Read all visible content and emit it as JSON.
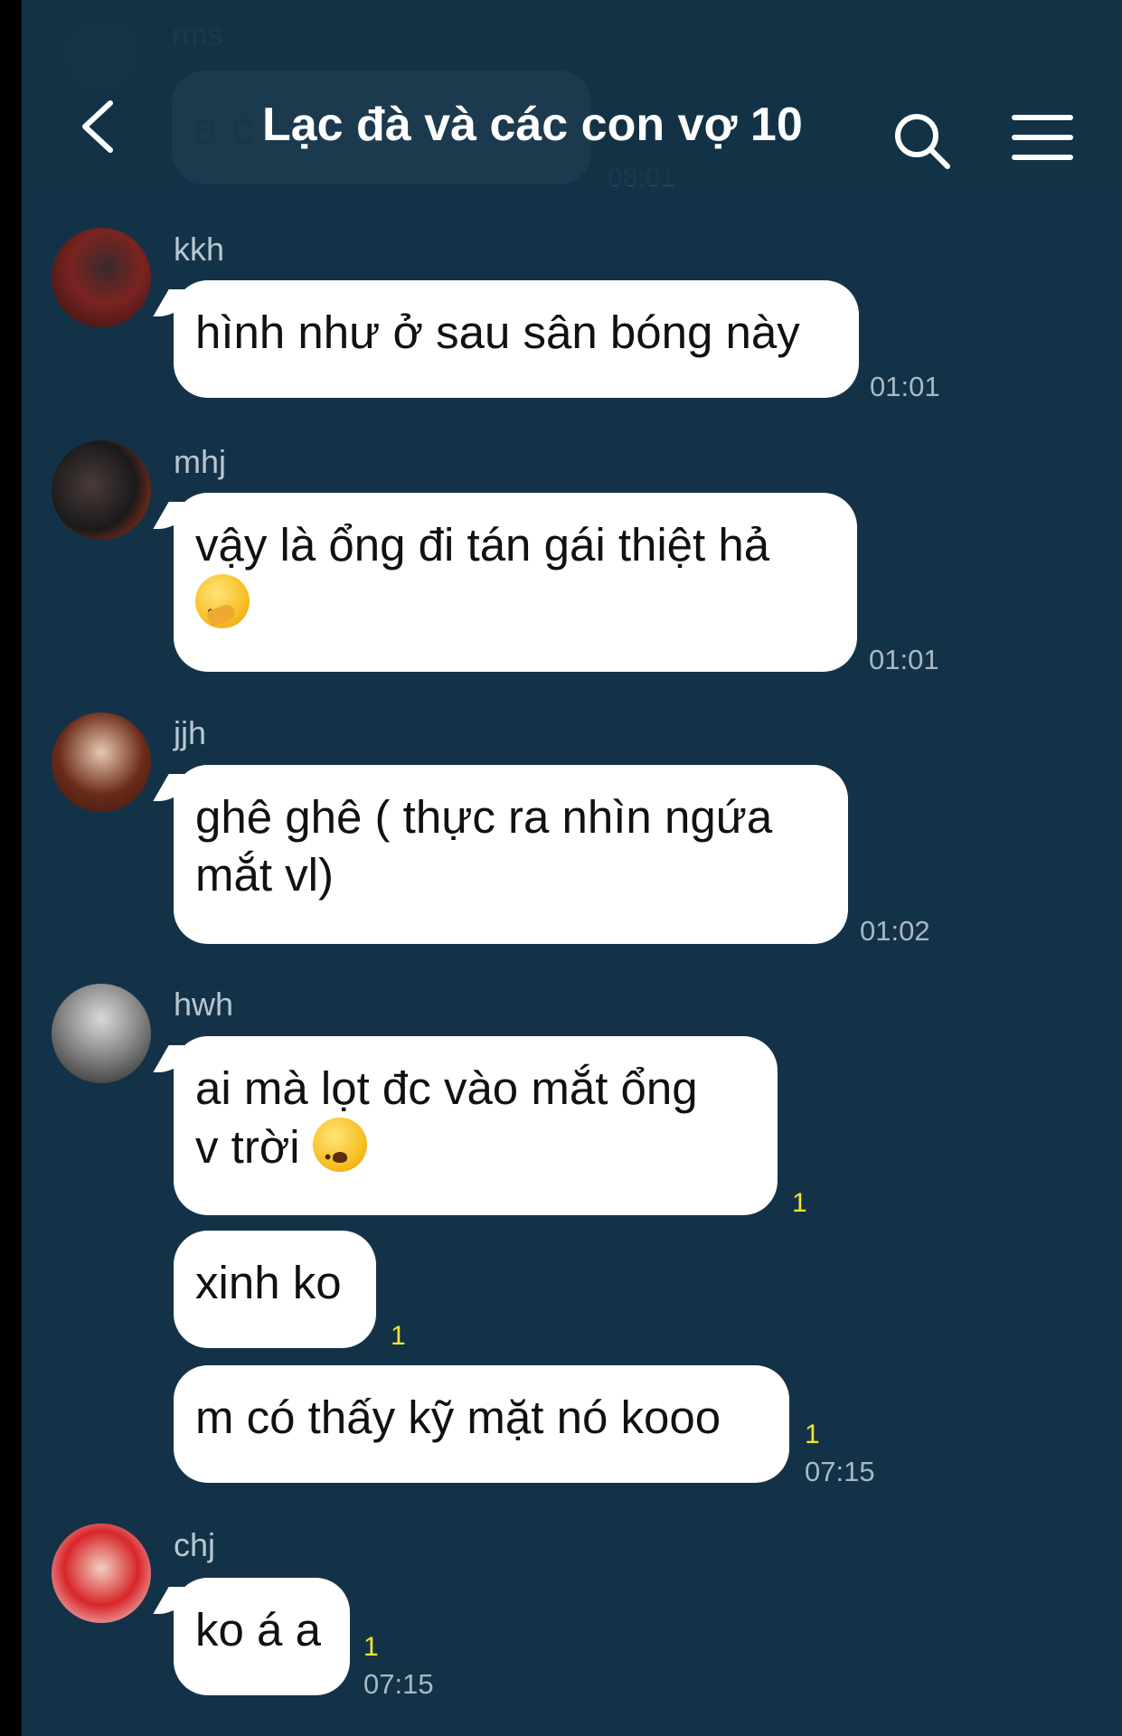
{
  "header": {
    "title": "Lạc đà và các con vợ 10"
  },
  "ghost_message": {
    "sender": "rms",
    "text": "a c",
    "time": "08:01"
  },
  "messages": [
    {
      "sender": "kkh",
      "lines": [
        "hình như ở sau sân bóng này"
      ],
      "time": "01:01"
    },
    {
      "sender": "mhj",
      "lines": [
        "vậy là ổng đi tán gái thiệt hả"
      ],
      "emoji": "thinking-face-emoji",
      "time": "01:01"
    },
    {
      "sender": "jjh",
      "lines": [
        "ghê ghê ( thực ra nhìn ngứa",
        "mắt vl)"
      ],
      "time": "01:02"
    },
    {
      "sender": "hwh",
      "lines": [
        "ai mà lọt đc vào mắt ổng",
        "v trời"
      ],
      "emoji": "worried-face-emoji",
      "unread": "1"
    },
    {
      "sender": "hwh",
      "lines": [
        "xinh ko"
      ],
      "unread": "1"
    },
    {
      "sender": "hwh",
      "lines": [
        "m có thấy kỹ mặt nó kooo"
      ],
      "unread": "1",
      "time": "07:15"
    },
    {
      "sender": "chj",
      "lines": [
        "ko á a"
      ],
      "unread": "1",
      "time": "07:15"
    }
  ],
  "colors": {
    "background": "#143247",
    "bubble": "#ffffff",
    "unread": "#f3e62c"
  }
}
